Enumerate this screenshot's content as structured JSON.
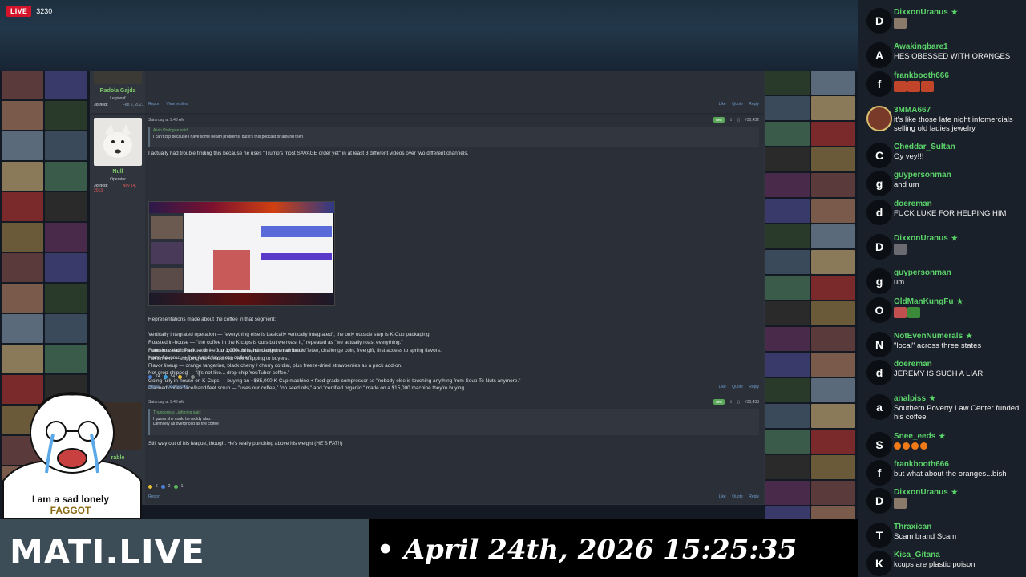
{
  "stream": {
    "live_label": "LIVE",
    "viewer_count": "3230"
  },
  "forum": {
    "post1": {
      "username": "Radola Gajda",
      "user_title": "Legionář",
      "joined_label": "Joined:",
      "joined_date": "Feb 6, 2021",
      "actions_left": [
        "Report",
        "View replies"
      ],
      "actions_right": [
        "Like",
        "Quote",
        "Reply"
      ]
    },
    "post2": {
      "username": "Null",
      "user_title": "Operator",
      "joined_label": "Joined:",
      "joined_date": "Nov 14, 2013",
      "timestamp": "Saturday at 9:43 AM",
      "new_badge": "New",
      "post_number": "#30,432",
      "quote_source": "Alvin Prologue said:",
      "quote_text": "I can't clip because I have some health problems, but it's this podcast or around then",
      "lines": [
        "I actually had trouble finding this because he uses \"Trump's most SAVAGE order yet\" in at least 3 different videos over two different channels.",
        "Representations made about the coffee in that segment:",
        "Vertically integrated operation — \"everything else is basically vertically integrated\"; the only outside step is K-Cup packaging.",
        "Roasted in-house — \"the coffee in the K cups is ours but we roast it,\" repeated as \"we actually roast everything.\"",
        "Hand-roasted, small batch — \"our coffee is hand roasted small batch.\"",
        "Hand-flavored — \"we hand flavor our coffee.\"",
        "Flavor lineup — orange tangerine, black cherry / cherry cordial, plus freeze-dried strawberries as a pack add-on.",
        "Not drop-shipped — \"it's not like... drop ship YouTuber coffee.\"",
        "Going fully in-house on K-Cups — buying an ~$85,000 K-Cup machine + food-grade compressor so \"nobody else is touching anything from Soup To Nuts anymore.\"",
        "Planned coffee face/hand/feet scrub — \"uses our coffee,\" \"no seed oils,\" and \"certified organic,\" made on a $15,000 machine they're buying.",
        "Founders Vault Pack — limited to 1,000 units, hand-signed numbered letter, challenge coin, free gift, first access to spring flavors.",
        "Fulfillment — shipping via Amazon for free shipping to buyers."
      ],
      "reactions": [
        "74",
        "54",
        "7",
        "3"
      ],
      "actions_left": [
        "Report",
        "View replies"
      ],
      "actions_right": [
        "Like",
        "Quote",
        "Reply"
      ]
    },
    "post3": {
      "username": "rable",
      "timestamp": "Saturday at 9:43 AM",
      "new_badge": "New",
      "post_number": "#30,433",
      "quote_source": "Thunderous Lightning said:",
      "quote_lines": [
        "I guess she could be moldy also.",
        "Definitely as overpriced as the coffee"
      ],
      "body": "Still way out of his league, though. He's really punching above his weight (HE'S FAT!!)",
      "reactions": [
        "6",
        "2",
        "1"
      ],
      "actions_left": [
        "Report"
      ],
      "actions_right": [
        "Like",
        "Quote",
        "Reply"
      ]
    }
  },
  "overlay": {
    "wojak_caption_line1": "I am a sad lonely",
    "wojak_caption_line2": "FAGGOT",
    "logo": "MATI.LIVE",
    "datetime": "• April 24th, 2026 15:25:35"
  },
  "chat": [
    {
      "initial": "D",
      "user": "DixxonUranus",
      "star": "★",
      "text": "",
      "emotes": [
        "#8a7a6a"
      ]
    },
    {
      "initial": "A",
      "user": "Awakingbare1",
      "text": "HES OBESSED WITH ORANGES"
    },
    {
      "initial": "f",
      "user": "frankbooth666",
      "text": "",
      "emotes": [
        "#c0452a",
        "#c0452a",
        "#c0452a"
      ]
    },
    {
      "initial": "",
      "user": "3MMA667",
      "text": "it's like those late night infomercials selling old ladies jewelry"
    },
    {
      "initial": "C",
      "user": "Cheddar_Sultan",
      "text": "Oy vey!!!"
    },
    {
      "initial": "g",
      "user": "guypersonman",
      "text": "and um"
    },
    {
      "initial": "d",
      "user": "doereman",
      "text": "FUCK LUKE FOR HELPING HIM"
    },
    {
      "initial": "D",
      "user": "DixxonUranus",
      "star": "★",
      "text": "",
      "emotes": [
        "#6a6a70"
      ]
    },
    {
      "initial": "g",
      "user": "guypersonman",
      "text": "um"
    },
    {
      "initial": "O",
      "user": "OldManKungFu",
      "star": "★",
      "text": "",
      "emotes": [
        "#c05050",
        "#3a8a3a"
      ]
    },
    {
      "initial": "N",
      "user": "NotEvenNumerals",
      "star": "★",
      "text": "\"local\" across three states"
    },
    {
      "initial": "d",
      "user": "doereman",
      "text": "JEREMY IS SUCH A LIAR"
    },
    {
      "initial": "a",
      "user": "analpiss",
      "star": "★",
      "text": "Southern Poverty Law Center funded his coffee"
    },
    {
      "initial": "S",
      "user": "Snee_eeds",
      "star": "★",
      "text": "",
      "oranges": 4
    },
    {
      "initial": "f",
      "user": "frankbooth666",
      "text": "but what about the oranges...bish"
    },
    {
      "initial": "D",
      "user": "DixxonUranus",
      "star": "★",
      "text": "",
      "emotes": [
        "#8a7a6a"
      ]
    },
    {
      "initial": "T",
      "user": "Thraxican",
      "text": "Scam brand Scam"
    },
    {
      "initial": "K",
      "user": "Kisa_Gitana",
      "text": "kcups are plastic poison"
    }
  ]
}
